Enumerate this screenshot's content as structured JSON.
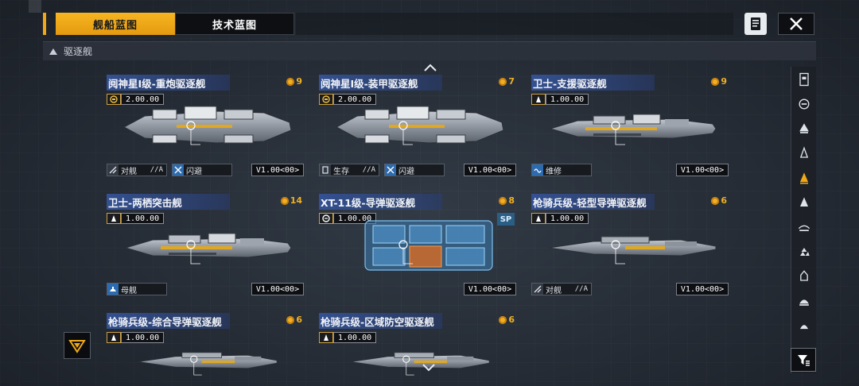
{
  "tabs": [
    {
      "label": "舰船蓝图",
      "active": true
    },
    {
      "label": "技术蓝图",
      "active": false
    }
  ],
  "category": {
    "label": "驱逐舰"
  },
  "colors": {
    "accent": "#f0a818",
    "name_bar": "#34529a",
    "cost_gold": "#f0b022"
  },
  "cards": [
    {
      "name": "阋神星I级-重炮驱逐舰",
      "count": "9",
      "cost": "2.00.00",
      "cost_icon": "supply-icon",
      "tags": [
        {
          "label": "对舰",
          "grade": "//A",
          "icon": "anti-ship-icon"
        },
        {
          "label": "闪避",
          "grade": "",
          "icon": "evasion-icon"
        }
      ],
      "version": "V1.00<00>",
      "sp": ""
    },
    {
      "name": "阋神星I级-装甲驱逐舰",
      "count": "7",
      "cost": "2.00.00",
      "cost_icon": "supply-icon",
      "tags": [
        {
          "label": "生存",
          "grade": "//A",
          "icon": "survival-icon"
        },
        {
          "label": "闪避",
          "grade": "",
          "icon": "evasion-icon"
        }
      ],
      "version": "V1.00<00>",
      "sp": ""
    },
    {
      "name": "卫士-支援驱逐舰",
      "count": "9",
      "cost": "1.00.00",
      "cost_icon": "rank-icon",
      "tags": [
        {
          "label": "维修",
          "grade": "",
          "icon": "repair-icon"
        }
      ],
      "version": "V1.00<00>",
      "sp": ""
    },
    {
      "name": "卫士-两栖突击舰",
      "count": "14",
      "cost": "1.00.00",
      "cost_icon": "rank-icon",
      "tags": [
        {
          "label": "母舰",
          "grade": "",
          "icon": "carrier-icon"
        }
      ],
      "version": "V1.00<00>",
      "sp": ""
    },
    {
      "name": "XT-11级-导弹驱逐舰",
      "count": "8",
      "cost": "1.00.00",
      "cost_icon": "target-icon",
      "tags": [],
      "version": "V1.00<00>",
      "sp": "SP"
    },
    {
      "name": "枪骑兵级-轻型导弹驱逐舰",
      "count": "6",
      "cost": "1.00.00",
      "cost_icon": "rank-icon",
      "tags": [
        {
          "label": "对舰",
          "grade": "//A",
          "icon": "anti-ship-icon"
        }
      ],
      "version": "V1.00<00>",
      "sp": ""
    },
    {
      "name": "枪骑兵级-综合导弹驱逐舰",
      "count": "6",
      "cost": "1.00.00",
      "cost_icon": "rank-icon",
      "tags": [],
      "version": "",
      "sp": ""
    },
    {
      "name": "枪骑兵级-区域防空驱逐舰",
      "count": "6",
      "cost": "1.00.00",
      "cost_icon": "rank-icon",
      "tags": [],
      "version": "",
      "sp": ""
    }
  ],
  "rail_icons": [
    "carrier-class-icon",
    "battlecruiser-class-icon",
    "cruiser-class-icon",
    "frigate-class-icon",
    "destroyer-class-icon",
    "corvette-class-icon",
    "aux-ship-icon",
    "fighter-icon",
    "gunship-icon",
    "mothership-icon",
    "misc-class-icon"
  ],
  "filter_icon": "filter-icon"
}
